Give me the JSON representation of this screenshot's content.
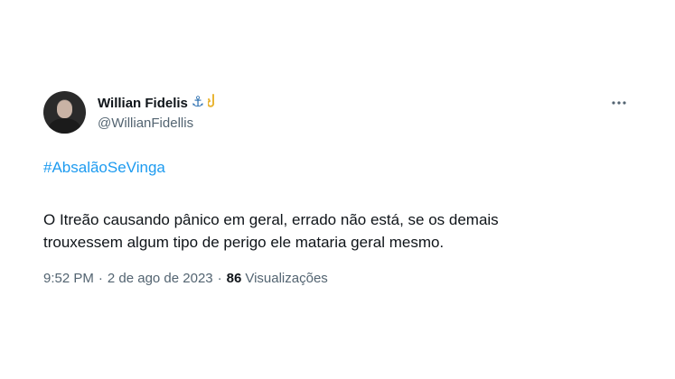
{
  "tweet": {
    "display_name": "Willian Fidelis",
    "badges": [
      "⚓",
      "🪝"
    ],
    "handle": "@WillianFidellis",
    "more_icon": "more-horizontal-icon",
    "hashtag": "#AbsalãoSeVinga",
    "body_line1": "O Itreão causando pânico em geral, errado não está, se os demais",
    "body_line2": "trouxessem algum tipo de perigo ele mataria geral mesmo.",
    "time": "9:52 PM",
    "date": "2 de ago de 2023",
    "views_count": "86",
    "views_label": "Visualizações",
    "separator": "·"
  },
  "colors": {
    "link": "#1d9bf0",
    "text": "#0f1419",
    "secondary": "#536471"
  }
}
